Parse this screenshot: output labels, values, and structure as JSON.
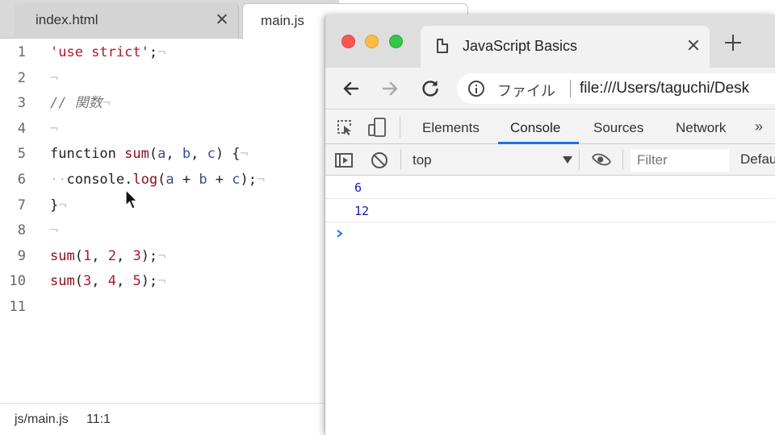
{
  "editor": {
    "tabs": [
      {
        "label": "index.html",
        "active": false
      },
      {
        "label": "main.js",
        "active": true
      }
    ],
    "lines": [
      {
        "n": "1",
        "tokens": [
          [
            "str",
            "'use strict'"
          ],
          [
            "",
            ";"
          ],
          [
            "ws",
            "¬"
          ]
        ]
      },
      {
        "n": "2",
        "tokens": [
          [
            "ws",
            "¬"
          ]
        ]
      },
      {
        "n": "3",
        "tokens": [
          [
            "cmt",
            "// 関数"
          ],
          [
            "ws",
            "¬"
          ]
        ]
      },
      {
        "n": "4",
        "tokens": [
          [
            "ws",
            "¬"
          ]
        ]
      },
      {
        "n": "5",
        "tokens": [
          [
            "",
            "function "
          ],
          [
            "fn",
            "sum"
          ],
          [
            "",
            "("
          ],
          [
            "par",
            "a"
          ],
          [
            "",
            ", "
          ],
          [
            "par",
            "b"
          ],
          [
            "",
            ", "
          ],
          [
            "par",
            "c"
          ],
          [
            "",
            ") {"
          ],
          [
            "ws",
            "¬"
          ]
        ]
      },
      {
        "n": "6",
        "tokens": [
          [
            "ws",
            "··"
          ],
          [
            "",
            "console."
          ],
          [
            "fn",
            "log"
          ],
          [
            "",
            "("
          ],
          [
            "par",
            "a"
          ],
          [
            "",
            " + "
          ],
          [
            "par",
            "b"
          ],
          [
            "",
            " + "
          ],
          [
            "par",
            "c"
          ],
          [
            "",
            ");"
          ],
          [
            "ws",
            "¬"
          ]
        ]
      },
      {
        "n": "7",
        "tokens": [
          [
            "",
            "}"
          ],
          [
            "ws",
            "¬"
          ]
        ]
      },
      {
        "n": "8",
        "tokens": [
          [
            "ws",
            "¬"
          ]
        ]
      },
      {
        "n": "9",
        "tokens": [
          [
            "fn",
            "sum"
          ],
          [
            "",
            "("
          ],
          [
            "num",
            "1"
          ],
          [
            "",
            ", "
          ],
          [
            "num",
            "2"
          ],
          [
            "",
            ", "
          ],
          [
            "num",
            "3"
          ],
          [
            "",
            ");"
          ],
          [
            "ws",
            "¬"
          ]
        ]
      },
      {
        "n": "10",
        "tokens": [
          [
            "fn",
            "sum"
          ],
          [
            "",
            "("
          ],
          [
            "num",
            "3"
          ],
          [
            "",
            ", "
          ],
          [
            "num",
            "4"
          ],
          [
            "",
            ", "
          ],
          [
            "num",
            "5"
          ],
          [
            "",
            ");"
          ],
          [
            "ws",
            "¬"
          ]
        ]
      },
      {
        "n": "11",
        "tokens": []
      }
    ],
    "status": {
      "file": "js/main.js",
      "position": "11:1"
    }
  },
  "browser": {
    "tab_title": "JavaScript Basics",
    "omnibox": {
      "label": "ファイル",
      "url": "file:///Users/taguchi/Desk"
    },
    "devtools": {
      "tabs": [
        "Elements",
        "Console",
        "Sources",
        "Network"
      ],
      "active_tab": "Console",
      "more": "»",
      "context": "top",
      "filter_placeholder": "Filter",
      "levels": "Default levels",
      "output": [
        "6",
        "12"
      ]
    }
  },
  "colors": {
    "string": "#b0182a",
    "function": "#8b0c1d",
    "param": "#3b4c8c",
    "console_value": "#1a1aa6",
    "accent": "#1a73e8"
  }
}
